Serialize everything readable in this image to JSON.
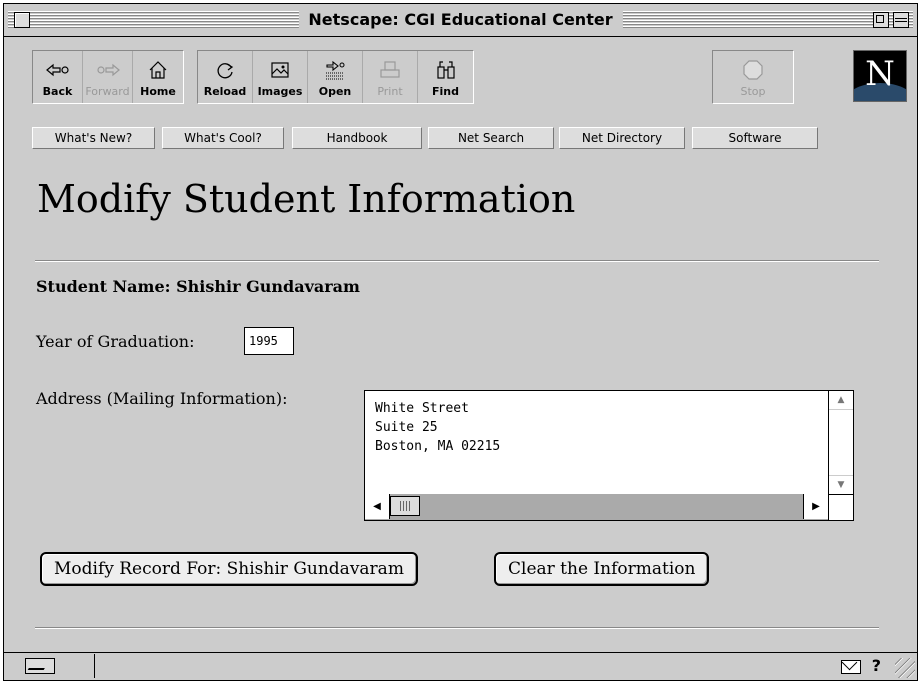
{
  "window": {
    "title": "Netscape: CGI Educational Center"
  },
  "toolbar": {
    "back": "Back",
    "forward": "Forward",
    "home": "Home",
    "reload": "Reload",
    "images": "Images",
    "open": "Open",
    "print": "Print",
    "find": "Find",
    "stop": "Stop",
    "logo_letter": "N"
  },
  "directory": {
    "whats_new": "What's New?",
    "whats_cool": "What's Cool?",
    "handbook": "Handbook",
    "net_search": "Net Search",
    "net_directory": "Net Directory",
    "software": "Software"
  },
  "page": {
    "title": "Modify Student Information",
    "student_name": "Student Name: Shishir Gundavaram",
    "year_label": "Year of Graduation:",
    "year_value": "1995",
    "address_label": "Address (Mailing Information):",
    "address_value": "White Street\nSuite 25\nBoston, MA 02215",
    "modify_button": "Modify Record For: Shishir Gundavaram",
    "clear_button": "Clear the Information"
  },
  "statusbar": {
    "help_glyph": "?"
  },
  "colors": {
    "window_bg": "#cccccc",
    "field_bg": "#ffffff",
    "text": "#000000",
    "disabled_text": "#999999"
  }
}
